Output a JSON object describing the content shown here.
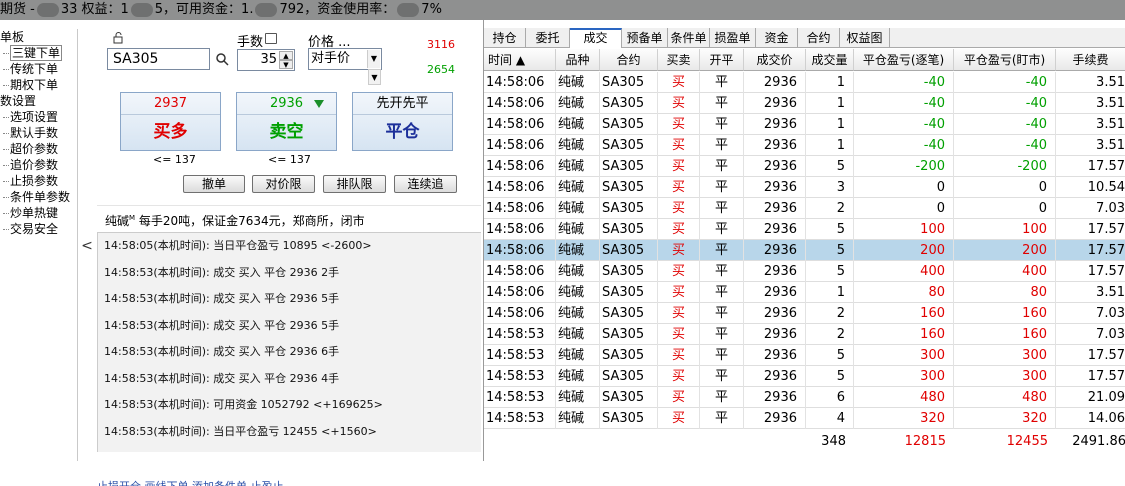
{
  "topbar": {
    "prefix": "期货 -",
    "part1": "33  权益：1",
    "part2": "5，可用资金：1.",
    "part3": "792，资金使用率：",
    "part4": "7%"
  },
  "sidebar": {
    "items": [
      {
        "label": "单板",
        "level": 1
      },
      {
        "label": "三键下单",
        "level": 2,
        "selected": true
      },
      {
        "label": "传统下单",
        "level": 2
      },
      {
        "label": "期权下单",
        "level": 2
      },
      {
        "label": "数设置",
        "level": 1
      },
      {
        "label": "选项设置",
        "level": 2
      },
      {
        "label": "默认手数",
        "level": 2
      },
      {
        "label": "超价参数",
        "level": 2
      },
      {
        "label": "追价参数",
        "level": 2
      },
      {
        "label": "止损参数",
        "level": 2
      },
      {
        "label": "条件单参数",
        "level": 2
      },
      {
        "label": "炒单热键",
        "level": 2
      },
      {
        "label": "交易安全",
        "level": 2
      }
    ],
    "collapse_glyph": "<"
  },
  "order": {
    "symbol": "SA305",
    "qty_label": "手数",
    "qty": "35",
    "price_label": "价格 ...",
    "price_value": "对手价",
    "limit_up": "3116",
    "limit_down": "2654",
    "buy": {
      "price": "2937",
      "label": "买多",
      "limit": "<= 137",
      "color": "#e00000"
    },
    "sell": {
      "price": "2936",
      "label": "卖空",
      "limit": "<= 137",
      "color": "#00a000"
    },
    "close": {
      "price": "先开先平",
      "label": "平仓",
      "color": "#1c2f9a"
    },
    "buttons": [
      "撤单",
      "对价限",
      "排队限",
      "连续追"
    ],
    "info_name": "纯碱",
    "info_sup": "M",
    "info_rest": " 每手20吨，保证金7634元，郑商所，闭市"
  },
  "log": [
    "14:58:05(本机时间): 当日平仓盈亏 10895 <-2600>",
    "14:58:53(本机时间): 成交  买入  平仓  2936  2手",
    "14:58:53(本机时间): 成交  买入  平仓  2936  5手",
    "14:58:53(本机时间): 成交  买入  平仓  2936  5手",
    "14:58:53(本机时间): 成交  买入  平仓  2936  6手",
    "14:58:53(本机时间): 成交  买入  平仓  2936  4手",
    "14:58:53(本机时间): 可用资金 1052792 <+169625>",
    "14:58:53(本机时间): 当日平仓盈亏 12455 <+1560>"
  ],
  "bottom_links": "止损开仓    画线下单    添加条件单    止盈止",
  "tabs": [
    {
      "label": "持仓"
    },
    {
      "label": "委托"
    },
    {
      "label": "成交",
      "active": true
    },
    {
      "label": "预备单"
    },
    {
      "label": "条件单"
    },
    {
      "label": "损盈单"
    },
    {
      "label": "资金"
    },
    {
      "label": "合约"
    },
    {
      "label": "权益图"
    }
  ],
  "table": {
    "columns": [
      "时间 ▲",
      "品种",
      "合约",
      "买卖",
      "开平",
      "成交价",
      "成交量",
      "平仓盈亏(逐笔)",
      "平仓盈亏(盯市)",
      "手续费"
    ],
    "rows": [
      [
        "14:58:06",
        "纯碱",
        "SA305",
        "买",
        "平",
        "2936",
        "1",
        "-40",
        "-40",
        "3.51"
      ],
      [
        "14:58:06",
        "纯碱",
        "SA305",
        "买",
        "平",
        "2936",
        "1",
        "-40",
        "-40",
        "3.51"
      ],
      [
        "14:58:06",
        "纯碱",
        "SA305",
        "买",
        "平",
        "2936",
        "1",
        "-40",
        "-40",
        "3.51"
      ],
      [
        "14:58:06",
        "纯碱",
        "SA305",
        "买",
        "平",
        "2936",
        "1",
        "-40",
        "-40",
        "3.51"
      ],
      [
        "14:58:06",
        "纯碱",
        "SA305",
        "买",
        "平",
        "2936",
        "5",
        "-200",
        "-200",
        "17.57"
      ],
      [
        "14:58:06",
        "纯碱",
        "SA305",
        "买",
        "平",
        "2936",
        "3",
        "0",
        "0",
        "10.54"
      ],
      [
        "14:58:06",
        "纯碱",
        "SA305",
        "买",
        "平",
        "2936",
        "2",
        "0",
        "0",
        "7.03"
      ],
      [
        "14:58:06",
        "纯碱",
        "SA305",
        "买",
        "平",
        "2936",
        "5",
        "100",
        "100",
        "17.57"
      ],
      [
        "14:58:06",
        "纯碱",
        "SA305",
        "买",
        "平",
        "2936",
        "5",
        "200",
        "200",
        "17.57"
      ],
      [
        "14:58:06",
        "纯碱",
        "SA305",
        "买",
        "平",
        "2936",
        "5",
        "400",
        "400",
        "17.57"
      ],
      [
        "14:58:06",
        "纯碱",
        "SA305",
        "买",
        "平",
        "2936",
        "1",
        "80",
        "80",
        "3.51"
      ],
      [
        "14:58:06",
        "纯碱",
        "SA305",
        "买",
        "平",
        "2936",
        "2",
        "160",
        "160",
        "7.03"
      ],
      [
        "14:58:53",
        "纯碱",
        "SA305",
        "买",
        "平",
        "2936",
        "2",
        "160",
        "160",
        "7.03"
      ],
      [
        "14:58:53",
        "纯碱",
        "SA305",
        "买",
        "平",
        "2936",
        "5",
        "300",
        "300",
        "17.57"
      ],
      [
        "14:58:53",
        "纯碱",
        "SA305",
        "买",
        "平",
        "2936",
        "5",
        "300",
        "300",
        "17.57"
      ],
      [
        "14:58:53",
        "纯碱",
        "SA305",
        "买",
        "平",
        "2936",
        "6",
        "480",
        "480",
        "21.09"
      ],
      [
        "14:58:53",
        "纯碱",
        "SA305",
        "买",
        "平",
        "2936",
        "4",
        "320",
        "320",
        "14.06"
      ]
    ],
    "selected_row": 8,
    "summary": {
      "qty": "348",
      "pnl_trade": "12815",
      "pnl_mtm": "12455",
      "fee": "2491.86"
    }
  },
  "colors": {
    "buy": "#e00000",
    "sell": "#00a000",
    "accent": "#2a66c2",
    "selected_row": "#b8d6ea"
  }
}
